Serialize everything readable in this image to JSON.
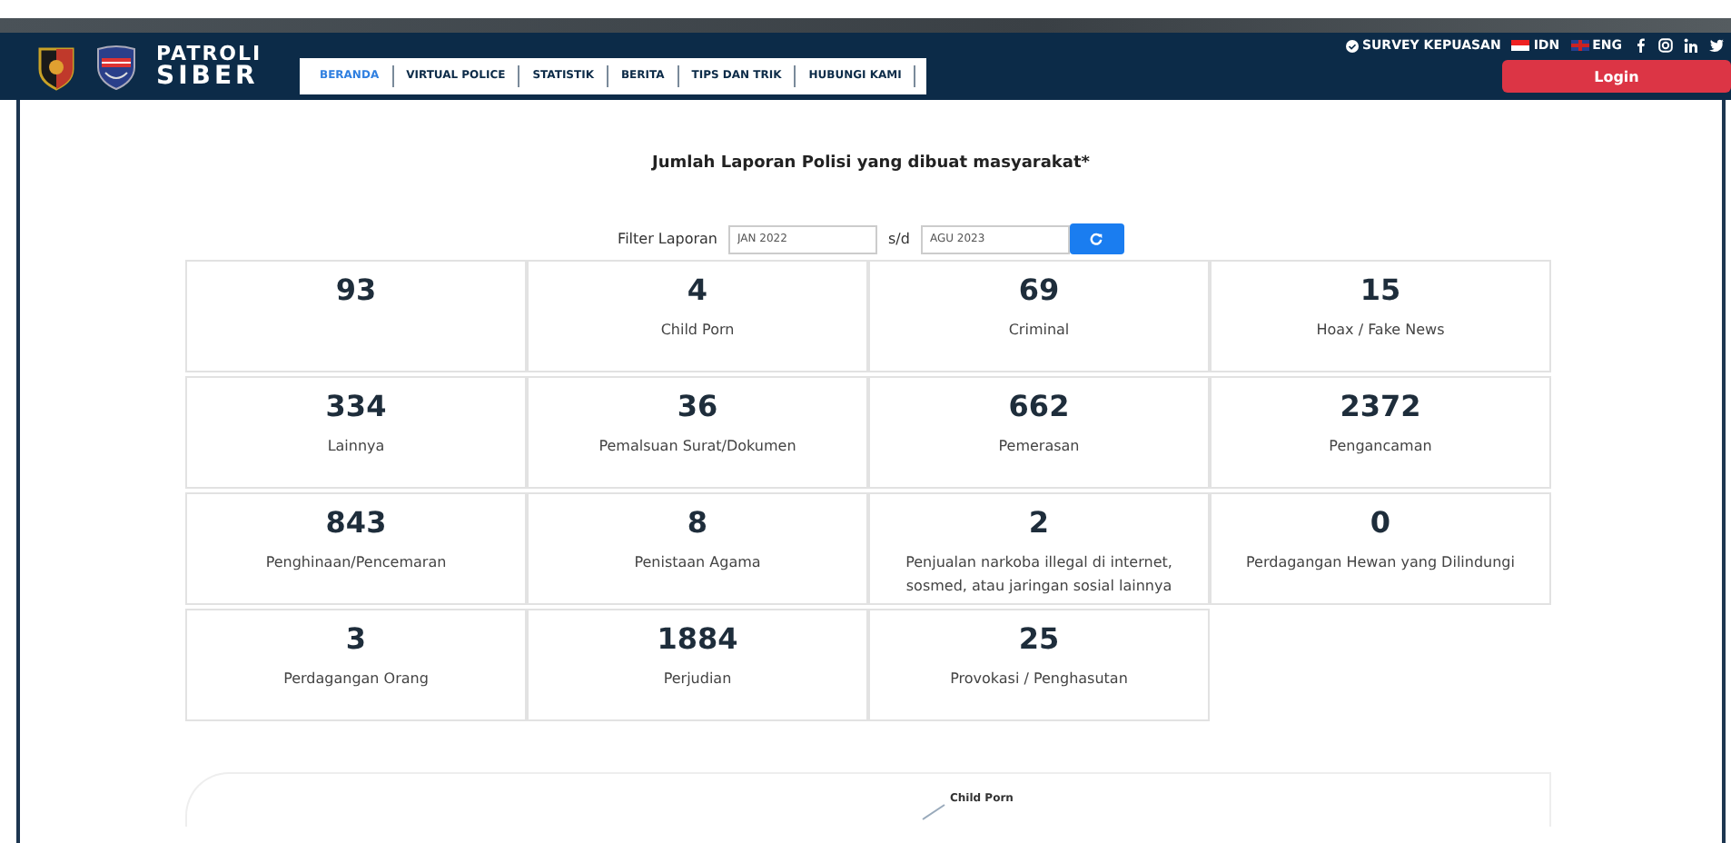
{
  "header": {
    "brand_line_1": "PATROLI",
    "brand_line_2": "SIBER",
    "nav": [
      {
        "label": "BERANDA",
        "selected": true
      },
      {
        "label": "VIRTUAL POLICE",
        "selected": false
      },
      {
        "label": "STATISTIK",
        "selected": false
      },
      {
        "label": "BERITA",
        "selected": false
      },
      {
        "label": "TIPS DAN TRIK",
        "selected": false
      },
      {
        "label": "HUBUNGI KAMI",
        "selected": false
      }
    ],
    "survey": "SURVEY KEPUASAN",
    "languages": [
      {
        "label": "IDN",
        "kind": "id"
      },
      {
        "label": "ENG",
        "kind": "gb"
      }
    ],
    "socials": [
      {
        "kind": "facebook"
      },
      {
        "kind": "instagram"
      },
      {
        "kind": "linkedin"
      },
      {
        "kind": "twitter"
      }
    ],
    "login": "Login"
  },
  "title": "Jumlah Laporan Polisi yang dibuat masyarakat*",
  "filter": {
    "label": "Filter Laporan",
    "from": "JAN 2022",
    "separator": "s/d",
    "to": "AGU 2023"
  },
  "stats": [
    {
      "value": "93"
    },
    {
      "value": "4",
      "label": "Child Porn"
    },
    {
      "value": "69",
      "label": "Criminal"
    },
    {
      "value": "15",
      "label": "Hoax / Fake News"
    },
    {
      "value": "334",
      "label": "Lainnya"
    },
    {
      "value": "36",
      "label": "Pemalsuan Surat/Dokumen"
    },
    {
      "value": "662",
      "label": "Pemerasan"
    },
    {
      "value": "2372",
      "label": "Pengancaman"
    },
    {
      "value": "843",
      "label": "Penghinaan/Pencemaran"
    },
    {
      "value": "8",
      "label": "Penistaan Agama"
    },
    {
      "value": "2",
      "label": "Penjualan narkoba illegal di internet, sosmed, atau jaringan sosial lainnya"
    },
    {
      "value": "0",
      "label": "Perdagangan Hewan yang Dilindungi"
    },
    {
      "value": "3",
      "label": "Perdagangan Orang"
    },
    {
      "value": "1884",
      "label": "Perjudian"
    },
    {
      "value": "25",
      "label": "Provokasi / Penghasutan"
    }
  ],
  "chart_labels": [
    "Child Porn"
  ]
}
